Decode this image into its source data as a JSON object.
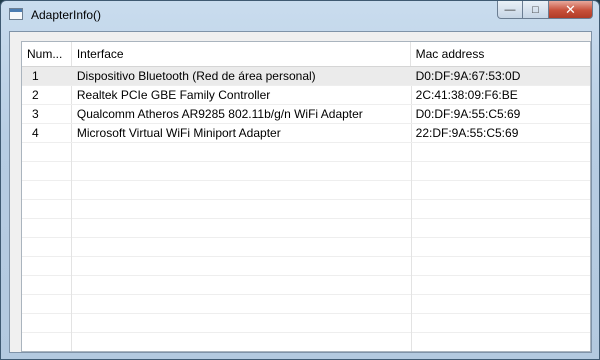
{
  "window": {
    "title": "AdapterInfo()",
    "minimize_glyph": "—",
    "maximize_glyph": "□",
    "close_glyph": "✕"
  },
  "table": {
    "columns": [
      "Num...",
      "Interface",
      "Mac address"
    ],
    "rows": [
      {
        "num": "1",
        "interface": "Dispositivo Bluetooth (Red de área personal)",
        "mac": "D0:DF:9A:67:53:0D"
      },
      {
        "num": "2",
        "interface": "Realtek PCIe GBE Family Controller",
        "mac": "2C:41:38:09:F6:BE"
      },
      {
        "num": "3",
        "interface": "Qualcomm Atheros AR9285 802.11b/g/n WiFi Adapter",
        "mac": "D0:DF:9A:55:C5:69"
      },
      {
        "num": "4",
        "interface": "Microsoft Virtual WiFi Miniport Adapter",
        "mac": "22:DF:9A:55:C5:69"
      }
    ],
    "selected_row": 0
  }
}
